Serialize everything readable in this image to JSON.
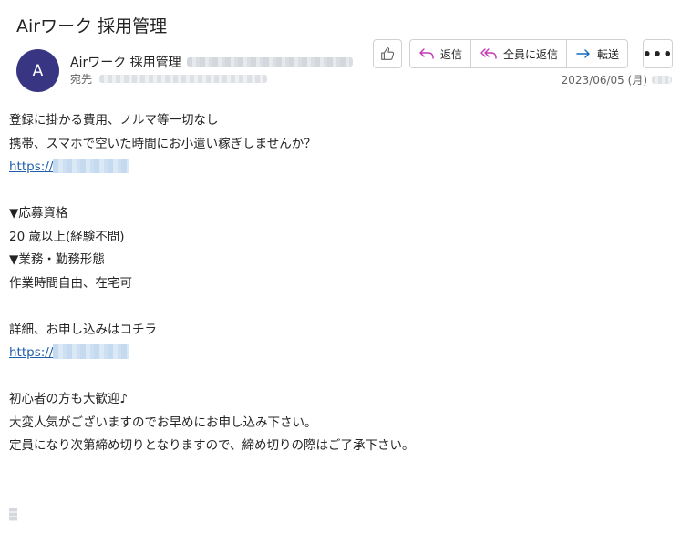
{
  "email": {
    "subject": "Airワーク 採用管理",
    "avatar_initial": "A",
    "sender_name": "Airワーク 採用管理",
    "to_label": "宛先",
    "date": "2023/06/05 (月)"
  },
  "toolbar": {
    "like_icon": "thumbs-up-icon",
    "reply_label": "返信",
    "reply_all_label": "全員に返信",
    "forward_label": "転送",
    "more_label": "•••",
    "accent_reply": "#c239b3",
    "accent_forward": "#0f6cbd"
  },
  "body": {
    "l1": "登録に掛かる費用、ノルマ等一切なし",
    "l2": "携帯、スマホで空いた時間にお小遣い稼ぎしませんか？",
    "link1": "https://",
    "l4": "▼応募資格",
    "l5": "20 歳以上(経験不問)",
    "l6": "▼業務・勤務形態",
    "l7": "作業時間自由、在宅可",
    "l8": "詳細、お申し込みはコチラ",
    "link2": "https://",
    "l10": "初心者の方も大歓迎♪",
    "l11": "大変人気がございますのでお早めにお申し込み下さい。",
    "l12": "定員になり次第締め切りとなりますので、締め切りの際はご了承下さい。"
  }
}
